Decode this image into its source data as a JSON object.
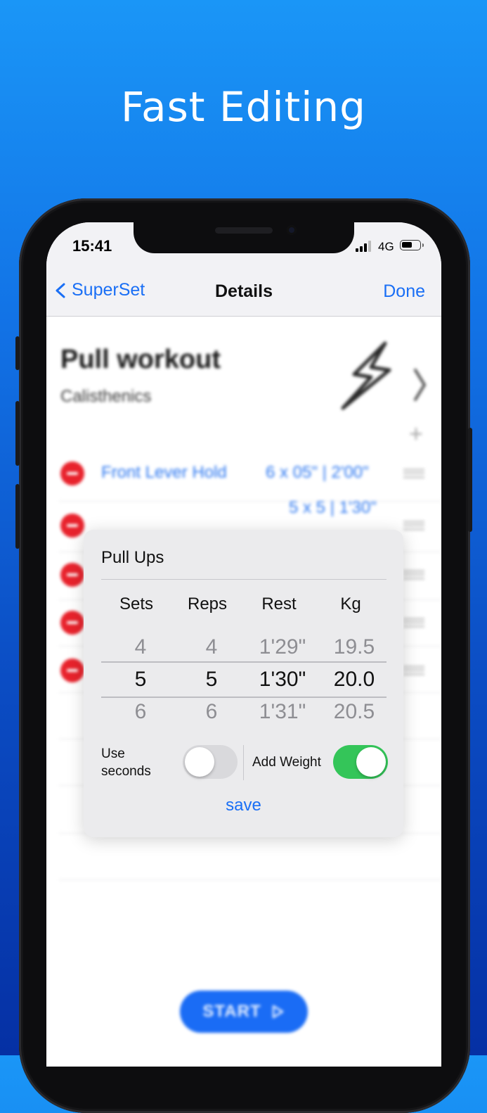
{
  "headline": "Fast Editing",
  "status": {
    "time": "15:41",
    "network": "4G"
  },
  "nav": {
    "back_label": "SuperSet",
    "title": "Details",
    "done_label": "Done"
  },
  "workout": {
    "title": "Pull workout",
    "subtitle": "Calisthenics",
    "exercises": [
      {
        "name": "Front Lever Hold",
        "value": "6 x 05\" | 2'00\""
      },
      {
        "name": "",
        "value": "5 x 5 | 1'30\""
      },
      {
        "name": "",
        "value": ""
      },
      {
        "name": "",
        "value": ""
      },
      {
        "name": "",
        "value": ""
      }
    ],
    "start_label": "START"
  },
  "editor": {
    "title": "Pull Ups",
    "columns": [
      "Sets",
      "Reps",
      "Rest",
      "Kg"
    ],
    "above": [
      "4",
      "4",
      "1'29\"",
      "19.5"
    ],
    "selected": [
      "5",
      "5",
      "1'30\"",
      "20.0"
    ],
    "below": [
      "6",
      "6",
      "1'31\"",
      "20.5"
    ],
    "use_seconds_label_1": "Use",
    "use_seconds_label_2": "seconds",
    "use_seconds": false,
    "add_weight_label": "Add Weight",
    "add_weight": true,
    "save_label": "save"
  },
  "colors": {
    "accent": "#1a6ff5",
    "toggle_on": "#34c559",
    "delete_red": "#e8222c"
  }
}
